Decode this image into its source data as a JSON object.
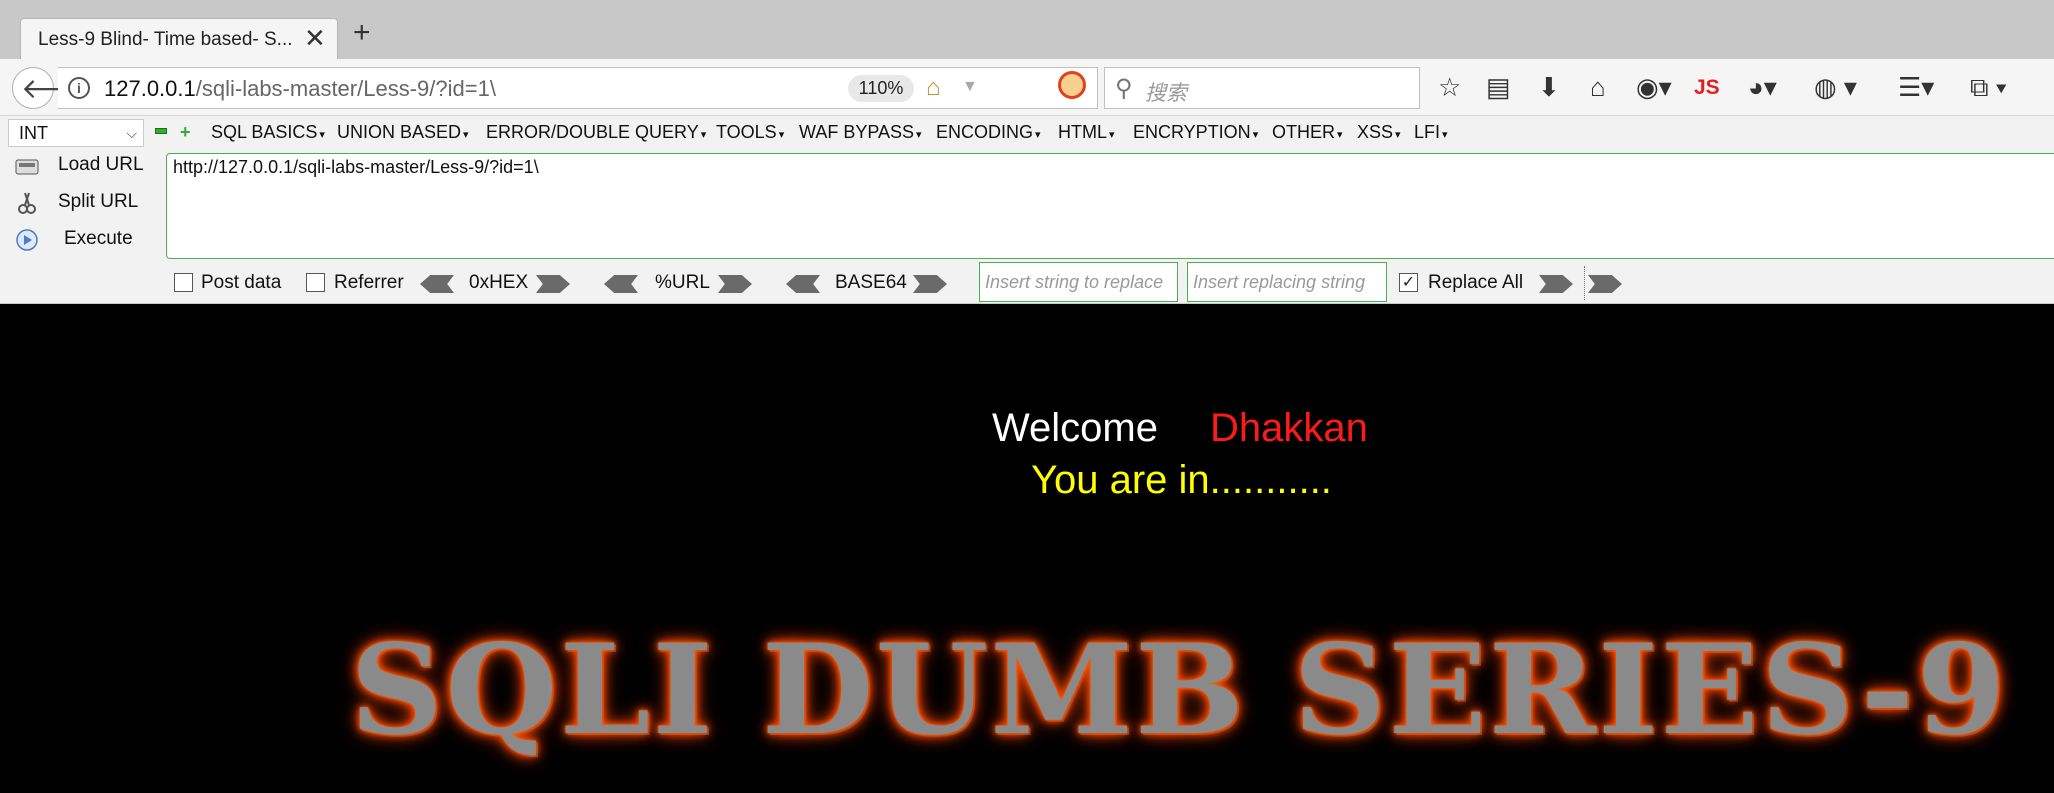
{
  "tab": {
    "title": "Less-9 Blind- Time based- S...",
    "close": "✕",
    "new": "+"
  },
  "nav": {
    "url_host": "127.0.0.1",
    "url_path": "/sqli-labs-master/Less-9/?id=1\\",
    "zoom": "110%",
    "search_placeholder": "搜索",
    "js_label": "JS"
  },
  "hackbar": {
    "type_value": "INT",
    "menus": [
      "SQL BASICS",
      "UNION BASED",
      "ERROR/DOUBLE QUERY",
      "TOOLS",
      "WAF BYPASS",
      "ENCODING",
      "HTML",
      "ENCRYPTION",
      "OTHER",
      "XSS",
      "LFI"
    ],
    "load_url": "Load URL",
    "split_url": "Split URL",
    "execute": "Execute",
    "url_value": "http://127.0.0.1/sqli-labs-master/Less-9/?id=1\\",
    "post_data": "Post data",
    "referrer": "Referrer",
    "hex": "0xHEX",
    "urlenc": "%URL",
    "base64": "BASE64",
    "replace_from_ph": "Insert string to replace",
    "replace_to_ph": "Insert replacing string",
    "replace_all": "Replace All",
    "replace_all_checked": true
  },
  "content": {
    "welcome": "Welcome",
    "name": "Dhakkan",
    "message": "You are in...........",
    "banner": "SQLI DUMB SERIES-9"
  },
  "colors": {
    "name": "#ff1a1a",
    "message": "#ffff00",
    "banner_glow": "#ff5a00",
    "hackbar_border": "#4caf50"
  }
}
